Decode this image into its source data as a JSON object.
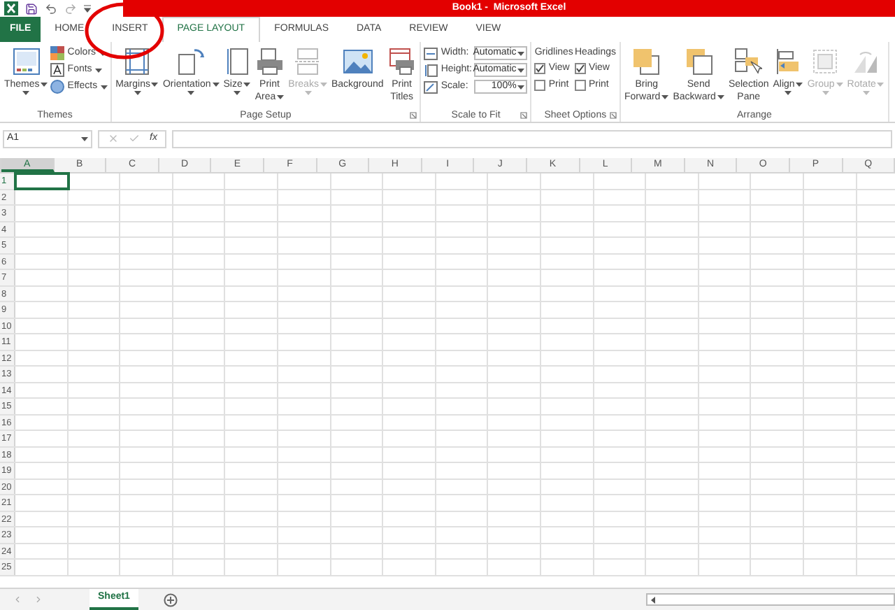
{
  "title_bar": {
    "title": "Book1 -  Microsoft Excel"
  },
  "tabs": [
    {
      "label": "FILE",
      "kind": "file",
      "selected": false
    },
    {
      "label": "HOME",
      "kind": "tab",
      "selected": false
    },
    {
      "label": "INSERT",
      "kind": "tab",
      "selected": false
    },
    {
      "label": "PAGE LAYOUT",
      "kind": "tab",
      "selected": true
    },
    {
      "label": "FORMULAS",
      "kind": "tab",
      "selected": false
    },
    {
      "label": "DATA",
      "kind": "tab",
      "selected": false
    },
    {
      "label": "REVIEW",
      "kind": "tab",
      "selected": false
    },
    {
      "label": "VIEW",
      "kind": "tab",
      "selected": false
    }
  ],
  "ribbon": {
    "groups": [
      {
        "label": "Themes",
        "launcher": false,
        "items": [
          {
            "kind": "large",
            "lines": [
              "Themes"
            ],
            "dropdown": true,
            "disabled": false
          },
          {
            "kind": "stack",
            "children": [
              {
                "kind": "small",
                "label": "Colors",
                "dropdown": true
              },
              {
                "kind": "small",
                "label": "Fonts",
                "dropdown": true
              },
              {
                "kind": "small",
                "label": "Effects",
                "dropdown": true
              }
            ]
          }
        ]
      },
      {
        "label": "Page Setup",
        "launcher": true,
        "items": [
          {
            "kind": "large",
            "lines": [
              "Margins"
            ],
            "dropdown": true,
            "disabled": false
          },
          {
            "kind": "large",
            "lines": [
              "Orientation"
            ],
            "dropdown": true,
            "disabled": false
          },
          {
            "kind": "large",
            "lines": [
              "Size"
            ],
            "dropdown": true,
            "disabled": false
          },
          {
            "kind": "large",
            "lines": [
              "Print",
              "Area"
            ],
            "dropdown": true,
            "disabled": false
          },
          {
            "kind": "large",
            "lines": [
              "Breaks"
            ],
            "dropdown": true,
            "disabled": true
          },
          {
            "kind": "large",
            "lines": [
              "Background"
            ],
            "dropdown": false,
            "disabled": false
          },
          {
            "kind": "large",
            "lines": [
              "Print",
              "Titles"
            ],
            "dropdown": false,
            "disabled": false
          }
        ]
      },
      {
        "label": "Scale to Fit",
        "launcher": true,
        "items": [
          {
            "kind": "stack",
            "children": [
              {
                "kind": "spin",
                "label": "Width:",
                "value": "Automatic"
              },
              {
                "kind": "spin",
                "label": "Height:",
                "value": "Automatic"
              },
              {
                "kind": "spin",
                "label": "Scale:",
                "value": "100%"
              }
            ]
          }
        ]
      },
      {
        "label": "Sheet Options",
        "launcher": true,
        "items": [
          {
            "kind": "stack",
            "heading": "Gridlines",
            "children": [
              {
                "kind": "check",
                "label": "View",
                "checked": true
              },
              {
                "kind": "check",
                "label": "Print",
                "checked": false
              }
            ]
          },
          {
            "kind": "stack",
            "heading": "Headings",
            "children": [
              {
                "kind": "check",
                "label": "View",
                "checked": true
              },
              {
                "kind": "check",
                "label": "Print",
                "checked": false
              }
            ]
          }
        ]
      },
      {
        "label": "Arrange",
        "launcher": false,
        "items": [
          {
            "kind": "large",
            "lines": [
              "Bring",
              "Forward"
            ],
            "dropdown": true,
            "disabled": false
          },
          {
            "kind": "large",
            "lines": [
              "Send",
              "Backward"
            ],
            "dropdown": true,
            "disabled": false
          },
          {
            "kind": "large",
            "lines": [
              "Selection",
              "Pane"
            ],
            "dropdown": false,
            "disabled": false
          },
          {
            "kind": "large",
            "lines": [
              "Align"
            ],
            "dropdown": true,
            "disabled": false
          },
          {
            "kind": "large",
            "lines": [
              "Group"
            ],
            "dropdown": true,
            "disabled": true
          },
          {
            "kind": "large",
            "lines": [
              "Rotate"
            ],
            "dropdown": true,
            "disabled": true
          }
        ]
      }
    ]
  },
  "formula_bar": {
    "name_box": "A1",
    "function_label": "fx"
  },
  "grid": {
    "columns": [
      {
        "label": "A",
        "selected": true
      },
      {
        "label": "B",
        "selected": false
      },
      {
        "label": "C",
        "selected": false
      },
      {
        "label": "D",
        "selected": false
      },
      {
        "label": "E",
        "selected": false
      },
      {
        "label": "F",
        "selected": false
      },
      {
        "label": "G",
        "selected": false
      },
      {
        "label": "H",
        "selected": false
      },
      {
        "label": "I",
        "selected": false
      },
      {
        "label": "J",
        "selected": false
      },
      {
        "label": "K",
        "selected": false
      },
      {
        "label": "L",
        "selected": false
      },
      {
        "label": "M",
        "selected": false
      },
      {
        "label": "N",
        "selected": false
      },
      {
        "label": "O",
        "selected": false
      },
      {
        "label": "P",
        "selected": false
      },
      {
        "label": "Q",
        "selected": false
      }
    ],
    "rows": [
      {
        "label": "1",
        "selected": true
      },
      {
        "label": "2",
        "selected": false
      },
      {
        "label": "3",
        "selected": false
      },
      {
        "label": "4",
        "selected": false
      },
      {
        "label": "5",
        "selected": false
      },
      {
        "label": "6",
        "selected": false
      },
      {
        "label": "7",
        "selected": false
      },
      {
        "label": "8",
        "selected": false
      },
      {
        "label": "9",
        "selected": false
      },
      {
        "label": "10",
        "selected": false
      },
      {
        "label": "11",
        "selected": false
      },
      {
        "label": "12",
        "selected": false
      },
      {
        "label": "13",
        "selected": false
      },
      {
        "label": "14",
        "selected": false
      },
      {
        "label": "15",
        "selected": false
      },
      {
        "label": "16",
        "selected": false
      },
      {
        "label": "17",
        "selected": false
      },
      {
        "label": "18",
        "selected": false
      },
      {
        "label": "19",
        "selected": false
      },
      {
        "label": "20",
        "selected": false
      },
      {
        "label": "21",
        "selected": false
      },
      {
        "label": "22",
        "selected": false
      },
      {
        "label": "23",
        "selected": false
      },
      {
        "label": "24",
        "selected": false
      },
      {
        "label": "25",
        "selected": false
      }
    ]
  },
  "sheet_tabs": [
    {
      "label": "Sheet1",
      "selected": true
    }
  ]
}
